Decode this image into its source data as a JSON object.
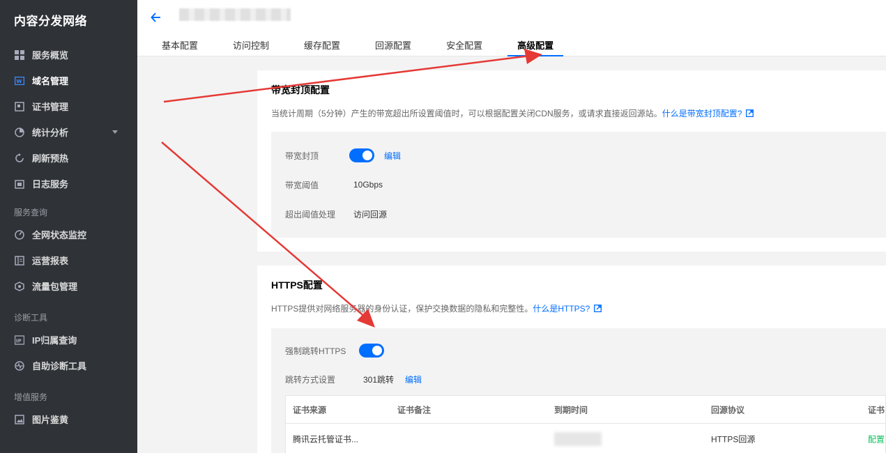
{
  "sidebar": {
    "brand": "内容分发网络",
    "items": [
      {
        "label": "服务概览",
        "icon": "grid-icon"
      },
      {
        "label": "域名管理",
        "icon": "domain-icon",
        "active": true
      },
      {
        "label": "证书管理",
        "icon": "certificate-icon"
      },
      {
        "label": "统计分析",
        "icon": "pie-chart-icon"
      },
      {
        "label": "刷新预热",
        "icon": "refresh-icon"
      },
      {
        "label": "日志服务",
        "icon": "folder-icon"
      }
    ],
    "group_query": "服务查询",
    "query_items": [
      {
        "label": "全网状态监控",
        "icon": "gauge-icon"
      },
      {
        "label": "运营报表",
        "icon": "report-icon"
      },
      {
        "label": "流量包管理",
        "icon": "package-icon"
      }
    ],
    "group_diag": "诊断工具",
    "diag_items": [
      {
        "label": "IP归属查询",
        "icon": "ip-icon"
      },
      {
        "label": "自助诊断工具",
        "icon": "pulse-icon"
      }
    ],
    "group_value": "增值服务",
    "value_items": [
      {
        "label": "图片鉴黄",
        "icon": "image-icon"
      }
    ]
  },
  "tabs": [
    "基本配置",
    "访问控制",
    "缓存配置",
    "回源配置",
    "安全配置",
    "高级配置"
  ],
  "active_tab": "高级配置",
  "bandwidth": {
    "title": "带宽封顶配置",
    "desc": "当统计周期（5分钟）产生的带宽超出所设置阈值时，可以根据配置关闭CDN服务，或请求直接返回源站。",
    "desc_link": "什么是带宽封顶配置?",
    "switch_label": "带宽封顶",
    "switch_on": true,
    "edit": "编辑",
    "threshold_label": "带宽阈值",
    "threshold_value": "10Gbps",
    "exceed_label": "超出阈值处理",
    "exceed_value": "访问回源"
  },
  "https": {
    "title": "HTTPS配置",
    "desc": "HTTPS提供对网络服务器的身份认证，保护交换数据的隐私和完整性。",
    "desc_link": "什么是HTTPS?",
    "force_label": "强制跳转HTTPS",
    "force_on": true,
    "redirect_label": "跳转方式设置",
    "redirect_value": "301跳转",
    "edit": "编辑",
    "table": {
      "headers": [
        "证书来源",
        "证书备注",
        "到期时间",
        "回源协议",
        "证书"
      ],
      "rows": [
        [
          "腾讯云托管证书...",
          "",
          "",
          "HTTPS回源",
          "配置"
        ]
      ]
    }
  },
  "colors": {
    "accent": "#006eff",
    "sidebar_bg": "#2f3338",
    "arrow": "#e53935",
    "success": "#0abf5b"
  }
}
